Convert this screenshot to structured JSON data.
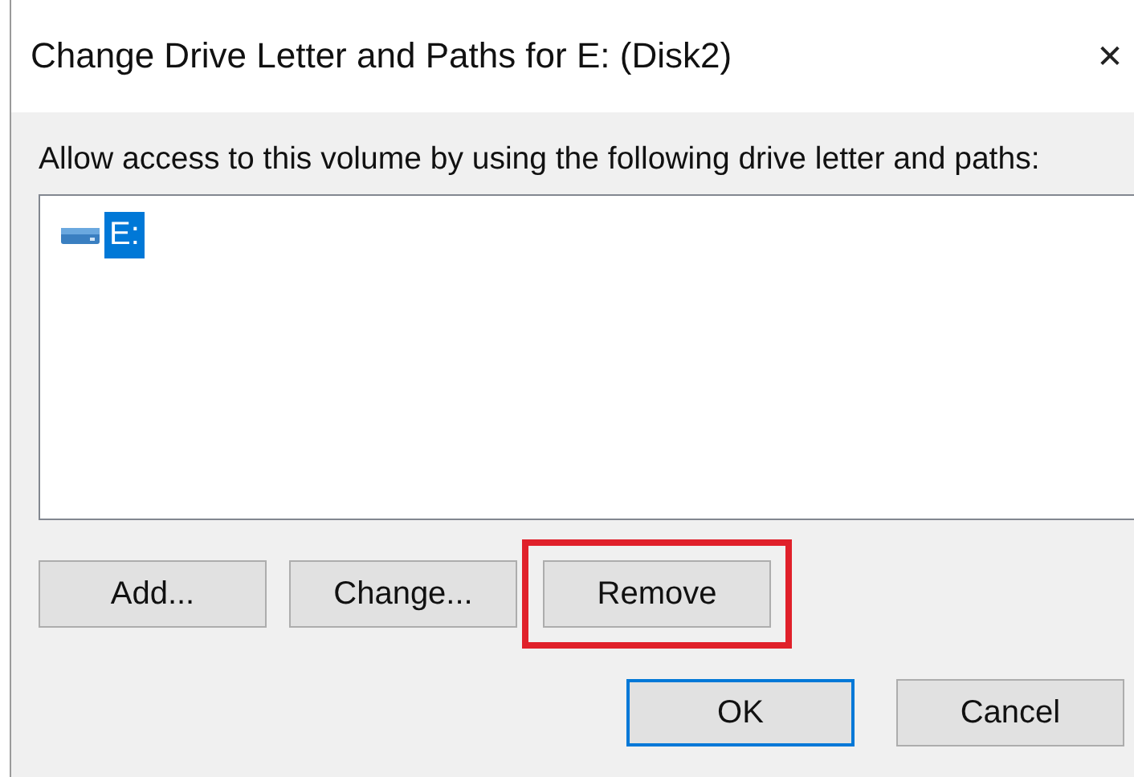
{
  "window": {
    "title": "Change Drive Letter and Paths for E: (Disk2)",
    "close": "✕"
  },
  "prompt": "Allow access to this volume by using the following drive letter and paths:",
  "list": {
    "items": [
      {
        "label": "E:",
        "selected": true
      }
    ]
  },
  "actions": [
    {
      "label": "Add..."
    },
    {
      "label": "Change..."
    },
    {
      "label": "Remove",
      "highlighted": true
    }
  ],
  "buttons": [
    {
      "label": "OK",
      "default": true
    },
    {
      "label": "Cancel",
      "default": false
    }
  ]
}
